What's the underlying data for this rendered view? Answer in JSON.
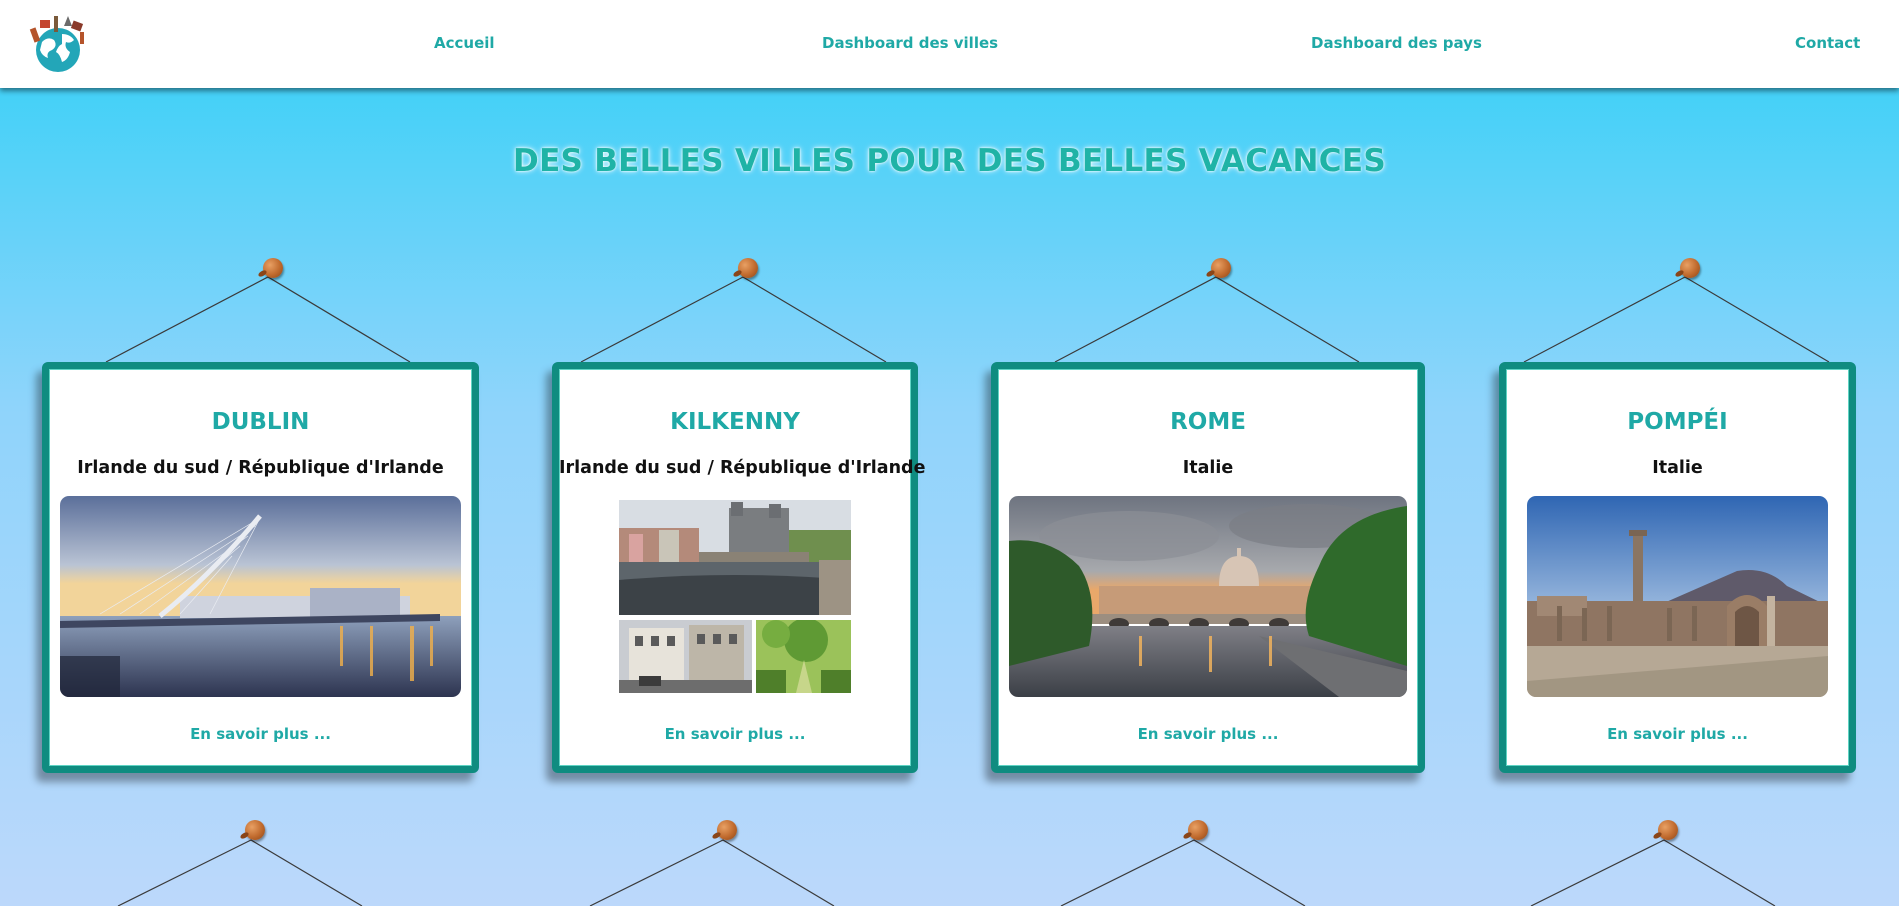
{
  "nav": {
    "home": "Accueil",
    "cities_dashboard": "Dashboard des villes",
    "countries_dashboard": "Dashboard des pays",
    "contact": "Contact"
  },
  "page": {
    "title": "DES BELLES VILLES POUR DES BELLES VACANCES"
  },
  "cards": [
    {
      "city": "DUBLIN",
      "country": "Irlande du sud / République d'Irlande",
      "link": "En savoir plus ..."
    },
    {
      "city": "KILKENNY",
      "country": "Irlande du sud / République d'Irlande",
      "link": "En savoir plus ..."
    },
    {
      "city": "ROME",
      "country": "Italie",
      "link": "En savoir plus ..."
    },
    {
      "city": "POMPÉI",
      "country": "Italie",
      "link": "En savoir plus ..."
    }
  ],
  "colors": {
    "accent": "#1fa9a6",
    "frame": "#0f8c80",
    "pin": "#c06a2d"
  },
  "icons": {
    "logo": "globe-travel-logo-icon",
    "pin": "pushpin-icon"
  }
}
